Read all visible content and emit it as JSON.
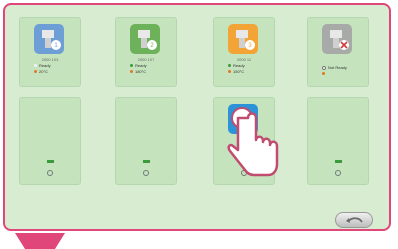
{
  "devices": [
    {
      "name": "2000 103",
      "status": "Ready",
      "temp": "20°C",
      "color": "#6d9fd6",
      "badge": "1",
      "status_color": "#f3f3f3",
      "temp_color": "#e07a28"
    },
    {
      "name": "2000 107",
      "status": "Ready",
      "temp": "180°C",
      "color": "#6db25a",
      "badge": "2",
      "status_color": "#3a9b3a",
      "temp_color": "#e07a28"
    },
    {
      "name": "2000 11",
      "status": "Ready",
      "temp": "150°C",
      "color": "#f2a436",
      "badge": "3",
      "status_color": "#3a9b3a",
      "temp_color": "#e07a28"
    },
    {
      "name": "",
      "status": "Not Ready",
      "temp": "",
      "color": "#a8aaa8",
      "badge": "✕",
      "status_color": "#999999",
      "temp_color": "#e07a28"
    }
  ],
  "back_label": "back"
}
